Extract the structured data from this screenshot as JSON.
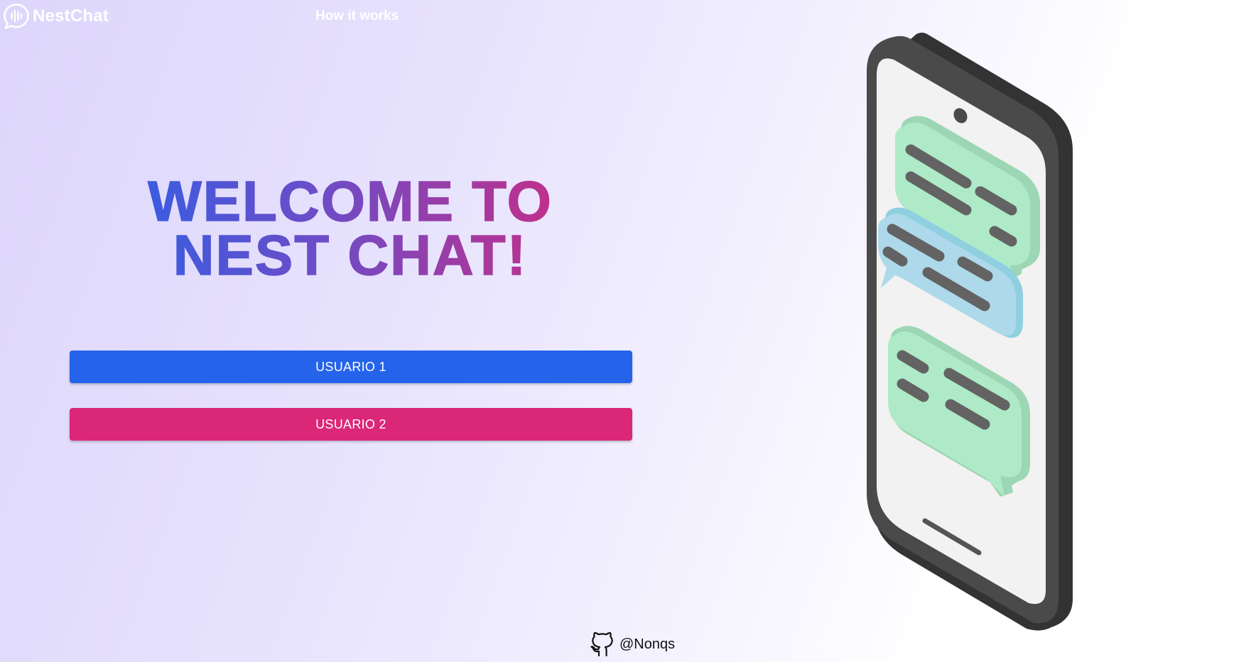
{
  "header": {
    "brand": "NestChat",
    "brand_icon": "chat-bubble-soundwave-icon",
    "nav_link": "How it works"
  },
  "hero": {
    "title_line1": "WELCOME TO",
    "title_line2": "NEST CHAT!"
  },
  "actions": {
    "user1_label": "USUARIO 1",
    "user2_label": "USUARIO 2"
  },
  "illustration": {
    "name": "phone-chat-illustration"
  },
  "footer": {
    "icon": "github-icon",
    "handle": "@Nonqs"
  },
  "colors": {
    "user1_button": "#2563eb",
    "user2_button": "#db2777",
    "title_gradient_start": "#2563eb",
    "title_gradient_end": "#db2777",
    "bubble_green": "#aeeac7",
    "bubble_blue": "#add9ea",
    "phone_body": "#4a4a4a"
  }
}
